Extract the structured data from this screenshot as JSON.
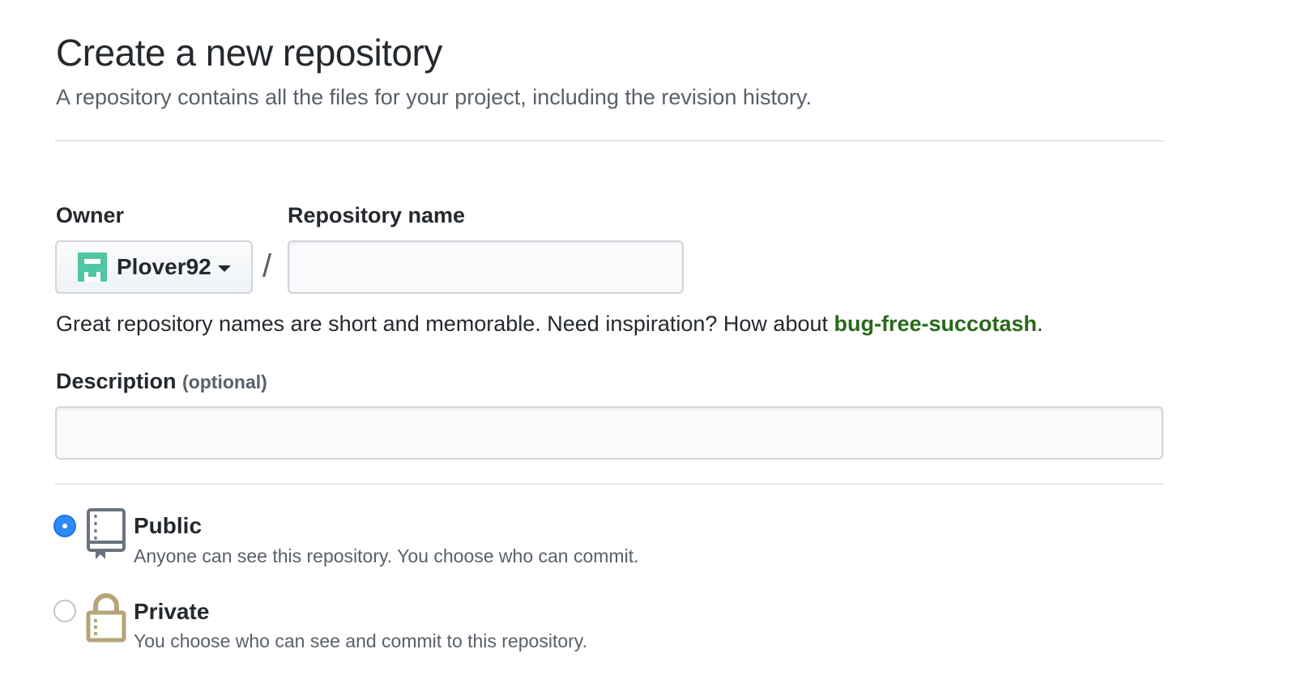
{
  "header": {
    "title": "Create a new repository",
    "subtitle": "A repository contains all the files for your project, including the revision history."
  },
  "owner": {
    "label": "Owner",
    "selected": "Plover92",
    "separator": "/"
  },
  "repo_name": {
    "label": "Repository name",
    "value": "",
    "hint_prefix": "Great repository names are short and memorable. Need inspiration? How about ",
    "hint_suggestion": "bug-free-succotash",
    "hint_suffix": "."
  },
  "description": {
    "label": "Description",
    "optional": "(optional)",
    "value": ""
  },
  "visibility": {
    "selected": "public",
    "options": [
      {
        "key": "public",
        "title": "Public",
        "description": "Anyone can see this repository. You choose who can commit.",
        "icon": "repo-book-icon"
      },
      {
        "key": "private",
        "title": "Private",
        "description": "You choose who can see and commit to this repository.",
        "icon": "lock-icon"
      }
    ]
  },
  "colors": {
    "suggestion": "#28691a",
    "radio_selected": "#2b8af7",
    "avatar": "#4fc7a2",
    "lock": "#b5a577",
    "book": "#6a737d"
  }
}
